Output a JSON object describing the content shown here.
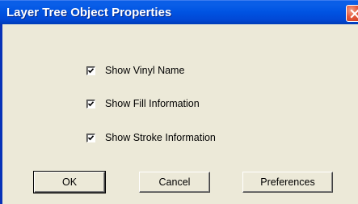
{
  "window": {
    "title": "Layer Tree Object Properties",
    "close_icon": "close-icon"
  },
  "options": [
    {
      "label": "Show Vinyl Name",
      "checked": true
    },
    {
      "label": "Show Fill Information",
      "checked": true
    },
    {
      "label": "Show Stroke Information",
      "checked": true
    }
  ],
  "buttons": {
    "ok_label": "OK",
    "cancel_label": "Cancel",
    "preferences_label": "Preferences"
  },
  "colors": {
    "titlebar": "#0054e3",
    "dialog_background": "#ece9d8",
    "close_button": "#e3563a"
  }
}
